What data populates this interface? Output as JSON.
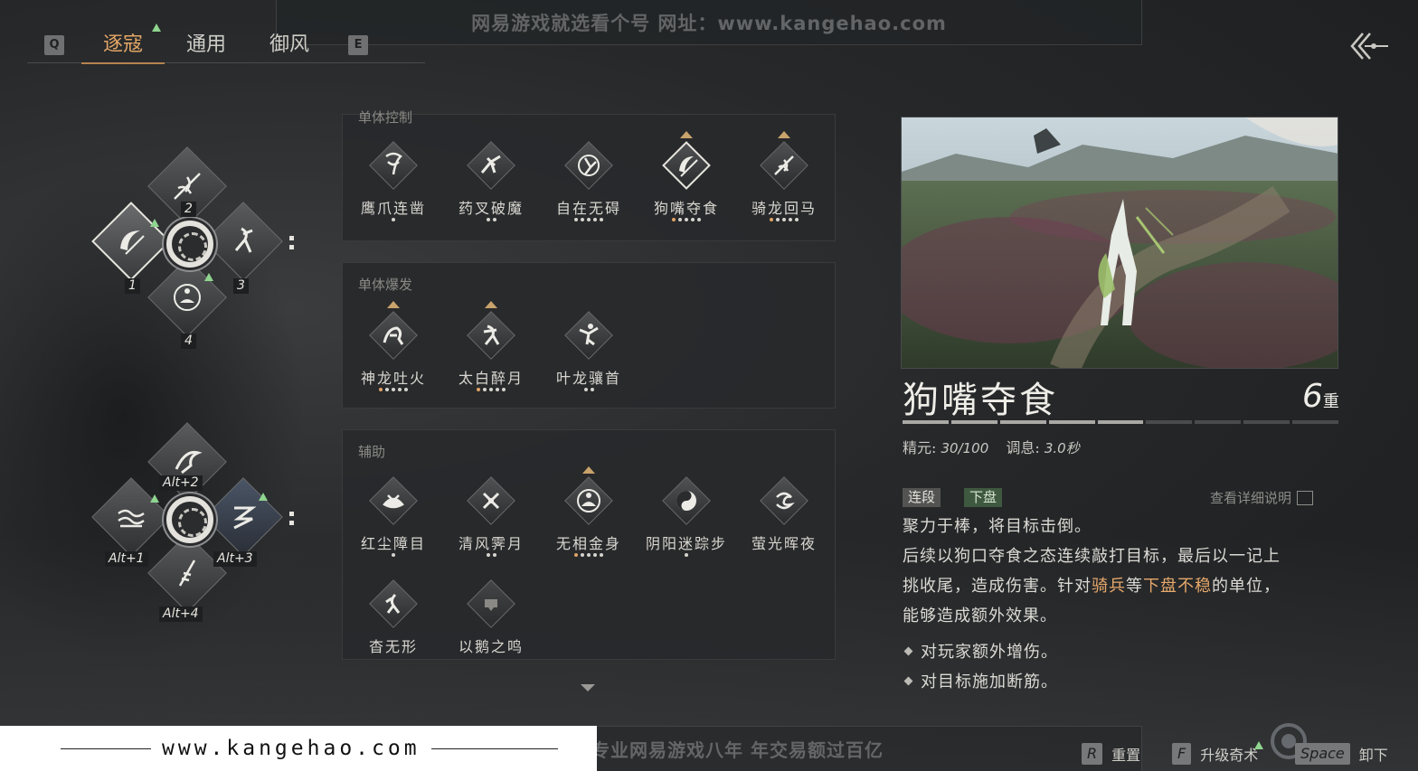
{
  "watermark": {
    "top_text": "网易游戏就选看个号  网址：www.kangehao.com",
    "bottom_text": "看个号专业网易游戏八年  年交易额过百亿",
    "site_url": "www.kangehao.com"
  },
  "tabs": {
    "key_left": "Q",
    "key_right": "E",
    "items": [
      {
        "label": "逐寇"
      },
      {
        "label": "通用"
      },
      {
        "label": "御风"
      }
    ]
  },
  "wheel_top": {
    "slots": [
      {
        "num": "1"
      },
      {
        "num": "2"
      },
      {
        "num": "3"
      },
      {
        "num": "4"
      }
    ]
  },
  "wheel_bottom": {
    "slots": [
      {
        "num": "Alt+1"
      },
      {
        "num": "Alt+2"
      },
      {
        "num": "Alt+3"
      },
      {
        "num": "Alt+4"
      }
    ]
  },
  "groups": [
    {
      "title": "单体控制",
      "skills": [
        {
          "name": "鹰爪连凿",
          "icon": "claw-icon"
        },
        {
          "name": "药叉破魔",
          "icon": "demon-strike-icon"
        },
        {
          "name": "自在无碍",
          "icon": "spin-kick-icon"
        },
        {
          "name": "狗嘴夺食",
          "icon": "crescent-strike-icon"
        },
        {
          "name": "骑龙回马",
          "icon": "spear-icon"
        }
      ]
    },
    {
      "title": "单体爆发",
      "skills": [
        {
          "name": "神龙吐火",
          "icon": "dragon-fire-icon"
        },
        {
          "name": "太白醉月",
          "icon": "drunk-moon-icon"
        },
        {
          "name": "叶龙骧首",
          "icon": "leaping-dragon-icon"
        }
      ]
    },
    {
      "title": "辅助",
      "skills": [
        {
          "name": "红尘障目",
          "icon": "dust-icon"
        },
        {
          "name": "清风霁月",
          "icon": "wind-blades-icon"
        },
        {
          "name": "无相金身",
          "icon": "meditate-icon"
        },
        {
          "name": "阴阳迷踪步",
          "icon": "yin-yang-icon"
        },
        {
          "name": "萤光晖夜",
          "icon": "swirl-icon"
        },
        {
          "name": "杳无形",
          "icon": "vanish-icon"
        },
        {
          "name": "以鹅之鸣",
          "icon": "horn-icon"
        }
      ]
    }
  ],
  "detail": {
    "title": "狗嘴夺食",
    "level": "6",
    "level_unit": "重",
    "level_progress": 0.6,
    "stats_label_1": "精元:",
    "stats_value_1": "30/100",
    "stats_label_2": "调息:",
    "stats_value_2": "3.0秒",
    "tags": [
      "连段",
      "下盘"
    ],
    "detail_link": "查看详细说明",
    "desc_line1": "聚力于棒，将目标击倒。",
    "desc_line2": "后续以狗口夺食之态连续敲打目标，最后以一记上",
    "desc_line3a": "挑收尾，造成伤害。针对",
    "desc_hl1": "骑兵",
    "desc_line3b": "等",
    "desc_hl2": "下盘不稳",
    "desc_line3c": "的单位，",
    "desc_line4": "能够造成额外效果。",
    "bullet1": "对玩家额外增伤。",
    "bullet2": "对目标施加断筋。"
  },
  "footer": {
    "reset_key": "R",
    "reset_label": "重置",
    "upgrade_key": "F",
    "upgrade_label": "升级奇术",
    "unload_key": "Space",
    "unload_label": "卸下"
  },
  "colors": {
    "accent_orange": "#e3a666",
    "highlight": "#e6a86b",
    "green_arrow": "#8fd48f",
    "gold_marker": "#c9a36c"
  }
}
